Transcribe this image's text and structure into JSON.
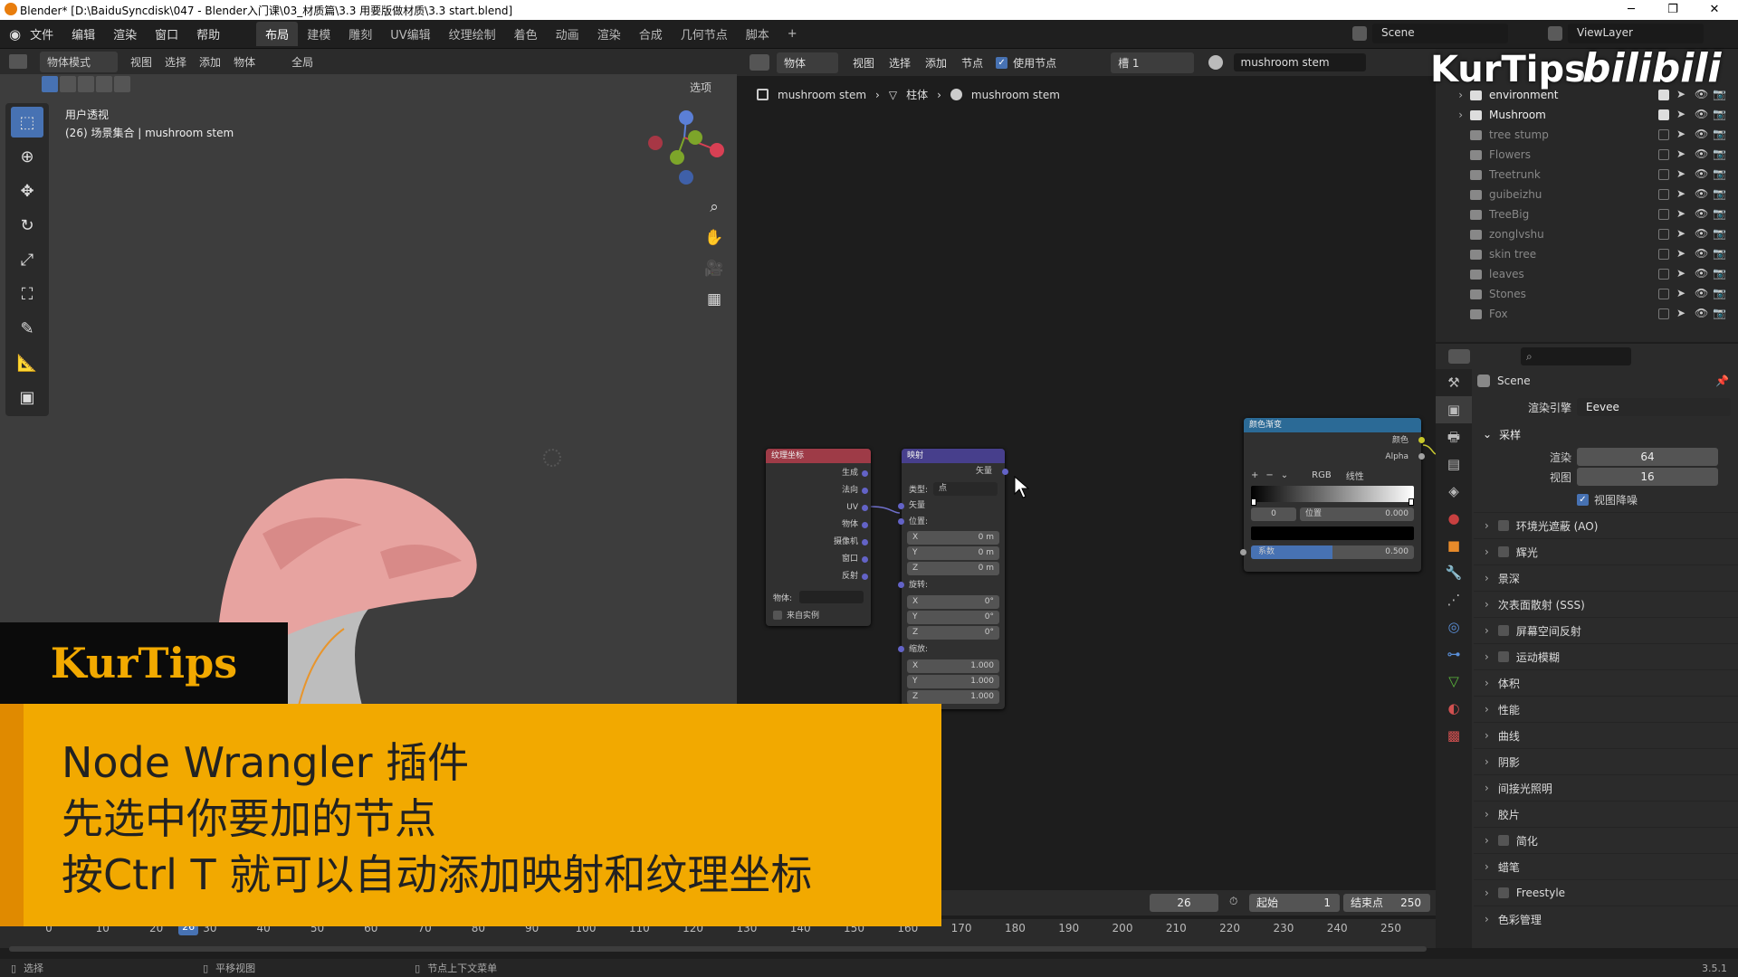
{
  "window": {
    "title": "Blender* [D:\\BaiduSyncdisk\\047 - Blender入门课\\03_材质篇\\3.3 用要版做材质\\3.3  start.blend]"
  },
  "menu": {
    "items": [
      "文件",
      "编辑",
      "渲染",
      "窗口",
      "帮助"
    ]
  },
  "workspaces": [
    "布局",
    "建模",
    "雕刻",
    "UV编辑",
    "纹理绘制",
    "着色",
    "动画",
    "渲染",
    "合成",
    "几何节点",
    "脚本"
  ],
  "workspace_add": "+",
  "scene_name": "Scene",
  "viewlayer_name": "ViewLayer",
  "viewport": {
    "mode": "物体模式",
    "menus": [
      "视图",
      "选择",
      "添加",
      "物体"
    ],
    "transform": "全局",
    "options": "选项",
    "overlay_title": "用户透视",
    "overlay_sub": "(26) 场景集合 | mushroom stem"
  },
  "node_editor": {
    "type": "物体",
    "menus": [
      "视图",
      "选择",
      "添加",
      "节点"
    ],
    "use_nodes_label": "使用节点",
    "slot": "槽 1",
    "material": "mushroom stem",
    "breadcrumb": [
      "mushroom stem",
      "柱体",
      "mushroom stem"
    ]
  },
  "node_texcoord": {
    "title": "纹理坐标",
    "outputs": [
      "生成",
      "法向",
      "UV",
      "物体",
      "摄像机",
      "窗口",
      "反射"
    ],
    "object_label": "物体:",
    "from_instancer": "来自实例"
  },
  "node_mapping": {
    "title": "映射",
    "output": "矢量",
    "type_label": "类型:",
    "type_value": "点",
    "vector_label": "矢量",
    "location_label": "位置:",
    "location": [
      {
        "axis": "X",
        "value": "0 m"
      },
      {
        "axis": "Y",
        "value": "0 m"
      },
      {
        "axis": "Z",
        "value": "0 m"
      }
    ],
    "rotation_label": "旋转:",
    "rotation": [
      {
        "axis": "X",
        "value": "0°"
      },
      {
        "axis": "Y",
        "value": "0°"
      },
      {
        "axis": "Z",
        "value": "0°"
      }
    ],
    "scale_label": "缩放:",
    "scale": [
      {
        "axis": "X",
        "value": "1.000"
      },
      {
        "axis": "Y",
        "value": "1.000"
      },
      {
        "axis": "Z",
        "value": "1.000"
      }
    ]
  },
  "node_colorramp": {
    "title": "颜色渐变",
    "out_color": "颜色",
    "out_alpha": "Alpha",
    "mode": "RGB",
    "interp": "线性",
    "stop_index": "0",
    "pos_label": "位置",
    "pos_value": "0.000",
    "fac_label": "系数",
    "fac_value": "0.500",
    "fac_fraction": 0.5
  },
  "outliner": {
    "items": [
      {
        "name": "environment",
        "enabled": true
      },
      {
        "name": "Mushroom",
        "enabled": true
      },
      {
        "name": "tree stump",
        "enabled": false
      },
      {
        "name": "Flowers",
        "enabled": false
      },
      {
        "name": "Treetrunk",
        "enabled": false
      },
      {
        "name": "guibeizhu",
        "enabled": false
      },
      {
        "name": "TreeBig",
        "enabled": false
      },
      {
        "name": "zonglvshu",
        "enabled": false
      },
      {
        "name": "skin tree",
        "enabled": false
      },
      {
        "name": "leaves",
        "enabled": false
      },
      {
        "name": "Stones",
        "enabled": false
      },
      {
        "name": "Fox",
        "enabled": false
      }
    ]
  },
  "properties": {
    "scene": "Scene",
    "engine_label": "渲染引擎",
    "engine_value": "Eevee",
    "sampling": "采样",
    "render_label": "渲染",
    "render_value": "64",
    "viewport_label": "视图",
    "viewport_value": "16",
    "denoise_label": "视图降噪",
    "panels": [
      {
        "label": "环境光遮蔽 (AO)",
        "check": true
      },
      {
        "label": "辉光",
        "check": true
      },
      {
        "label": "景深",
        "check": false
      },
      {
        "label": "次表面散射 (SSS)",
        "check": false
      },
      {
        "label": "屏幕空间反射",
        "check": true
      },
      {
        "label": "运动模糊",
        "check": true
      },
      {
        "label": "体积",
        "check": false
      },
      {
        "label": "性能",
        "check": false
      },
      {
        "label": "曲线",
        "check": false
      },
      {
        "label": "阴影",
        "check": false
      },
      {
        "label": "间接光照明",
        "check": false
      },
      {
        "label": "胶片",
        "check": false
      },
      {
        "label": "简化",
        "check": true
      },
      {
        "label": "蜡笔",
        "check": false
      },
      {
        "label": "Freestyle",
        "check": true
      },
      {
        "label": "色彩管理",
        "check": false
      }
    ]
  },
  "timeline": {
    "current": "26",
    "start_label": "起始",
    "start": "1",
    "end_label": "结束点",
    "end": "250",
    "ticks": [
      "0",
      "10",
      "20",
      "30",
      "40",
      "50",
      "60",
      "70",
      "80",
      "90",
      "100",
      "110",
      "120",
      "130",
      "140",
      "150",
      "160",
      "170",
      "180",
      "190",
      "200",
      "210",
      "220",
      "230",
      "240",
      "250"
    ],
    "playhead_label": "26"
  },
  "status": {
    "select": "选择",
    "pan": "平移视图",
    "context": "节点上下文菜单",
    "version": "3.5.1"
  },
  "overlay_logo": {
    "kurtips": "KurTips",
    "bilibili": "bilibili"
  },
  "banner": {
    "brand": "KurTips",
    "lines": [
      "Node Wrangler 插件",
      "先选中你要加的节点",
      "按Ctrl T 就可以自动添加映射和纹理坐标"
    ]
  },
  "colors": {
    "accent": "#4772b3",
    "banner": "#f2a900",
    "texcoord_header": "#9e3b47",
    "mapping_header": "#473f8c",
    "ramp_header": "#2b6a96"
  }
}
